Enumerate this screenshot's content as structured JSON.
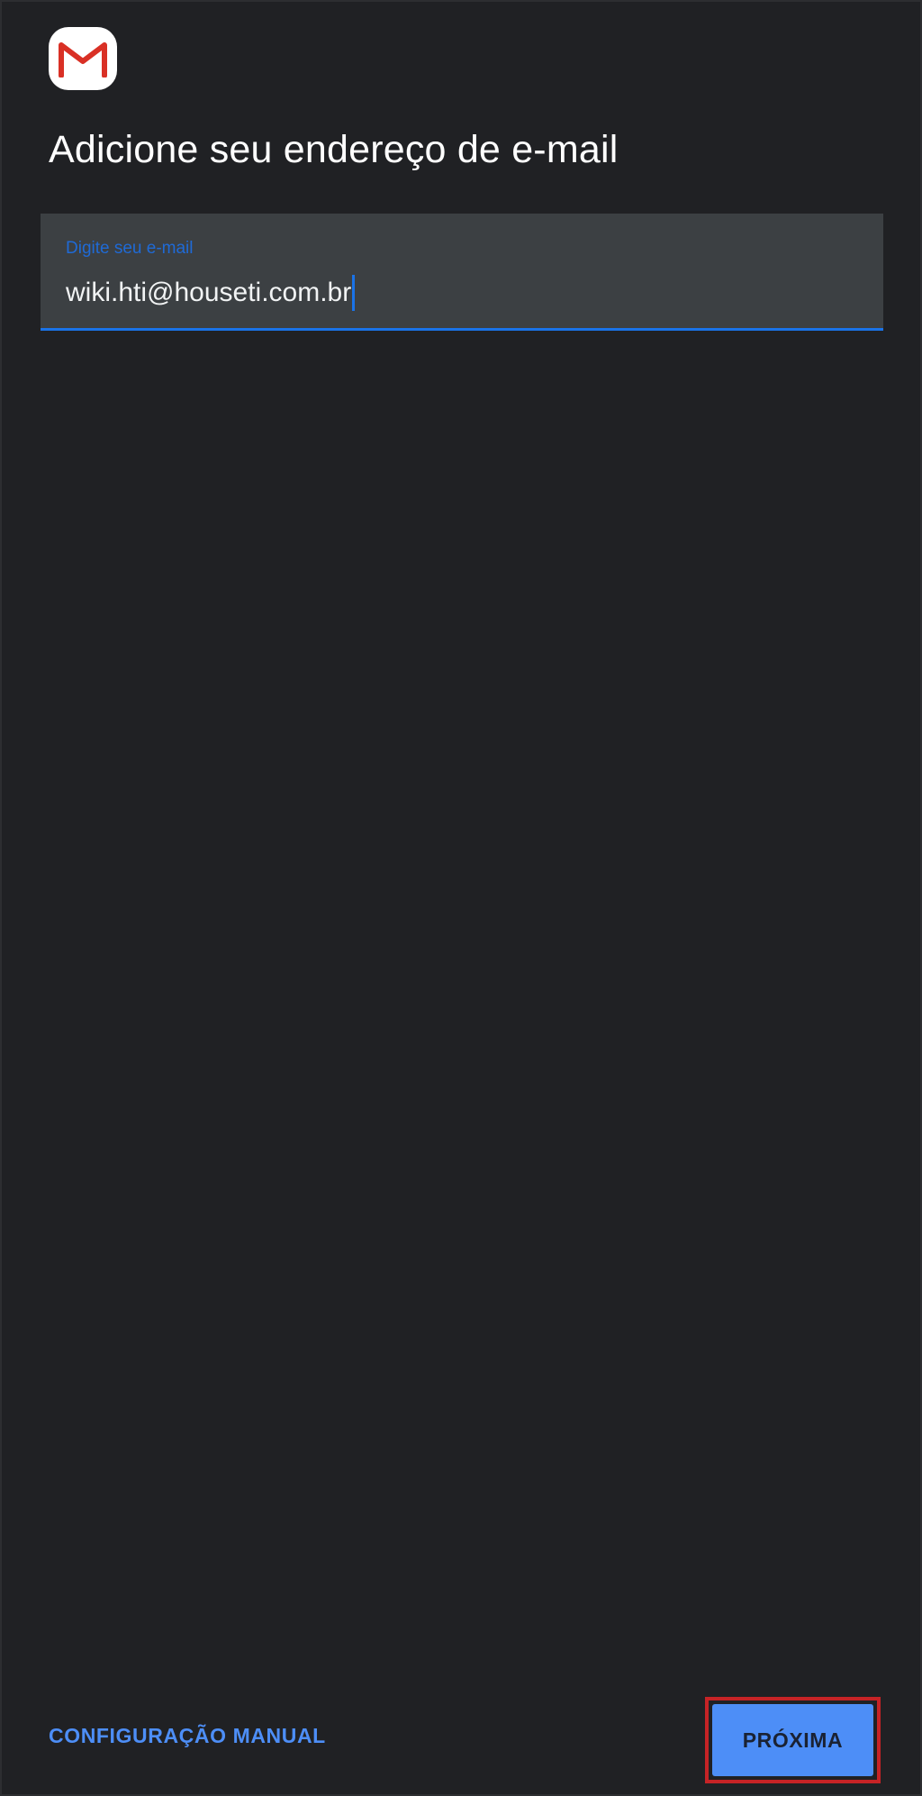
{
  "header": {
    "logo_icon": "gmail-icon",
    "title": "Adicione seu endereço de e-mail"
  },
  "email_field": {
    "label": "Digite seu e-mail",
    "value": "wiki.hti@houseti.com.br",
    "focused": true
  },
  "footer": {
    "manual_config_label": "CONFIGURAÇÃO MANUAL",
    "next_label": "PRÓXIMA"
  },
  "colors": {
    "background": "#202124",
    "field_background": "#3c4043",
    "accent": "#4d8ef7",
    "focus_underline": "#1a73e8",
    "highlight_outline": "#c62326",
    "gmail_red": "#d93025"
  }
}
